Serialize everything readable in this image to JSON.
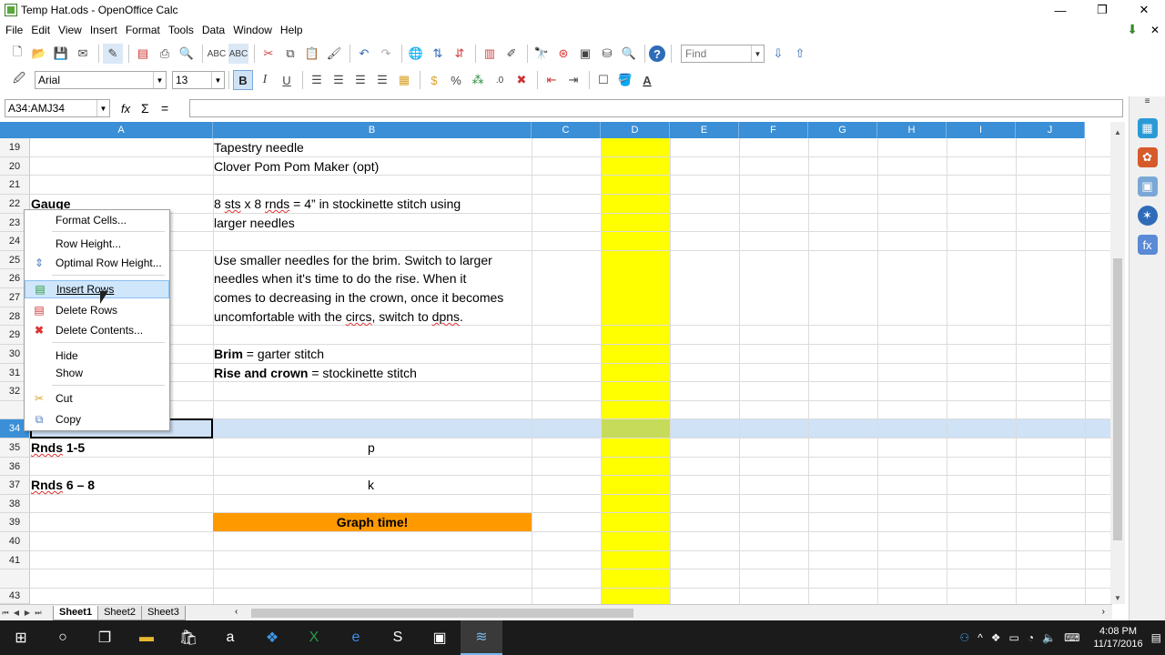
{
  "window": {
    "title": "Temp Hat.ods - OpenOffice Calc",
    "minimize": "—",
    "restore": "❐",
    "close": "✕"
  },
  "menu": [
    "File",
    "Edit",
    "View",
    "Insert",
    "Format",
    "Tools",
    "Data",
    "Window",
    "Help"
  ],
  "toolbar": {
    "find_placeholder": "Find"
  },
  "formatting": {
    "font_name": "Arial",
    "font_size": "13",
    "bold": "B",
    "italic": "I",
    "underline": "U"
  },
  "formula_bar": {
    "name_box": "A34:AMJ34",
    "fx": "fx",
    "sigma": "Σ",
    "equals": "=",
    "content": ""
  },
  "columns": [
    "A",
    "B",
    "C",
    "D",
    "E",
    "F",
    "G",
    "H",
    "I",
    "J"
  ],
  "rows": [
    "19",
    "20",
    "21",
    "22",
    "23",
    "24",
    "25",
    "26",
    "27",
    "28",
    "29",
    "30",
    "31",
    "32",
    "34",
    "35",
    "36",
    "37",
    "38",
    "39",
    "40",
    "41",
    "43"
  ],
  "cells": {
    "b19": "Tapestry needle",
    "b20": "Clover Pom Pom Maker (opt)",
    "a22": "Gauge",
    "b22_pre": "8 ",
    "b22_sts": "sts",
    "b22_mid": " x 8 ",
    "b22_rnds": "rnds",
    "b22_post": " = 4”  in stockinette stitch using",
    "b23": "larger needles",
    "b25": "Use smaller needles for the brim. Switch to larger",
    "b26": "needles when it's time to do the rise. When it",
    "b27": "comes to decreasing in the crown, once it becomes",
    "b28_pre": "uncomfortable with the ",
    "b28_circs": "circs",
    "b28_mid": ", switch to ",
    "b28_dpns": "dpns",
    "b28_post": ".",
    "b30_bold": "Brim",
    "b30_rest": " = garter stitch",
    "b31_bold": "Rise and crown",
    "b31_rest": " = stockinette stitch",
    "a35_rnds": "Rnds",
    "a35_rest": " 1-5",
    "b35": "p",
    "a37_rnds": "Rnds",
    "a37_rest": " 6 – 8",
    "b37": "k",
    "b39": "Graph time!"
  },
  "context_menu": [
    {
      "label": "Format Cells...",
      "icon": "none"
    },
    {
      "label": "Row Height...",
      "icon": "none"
    },
    {
      "label": "Optimal Row Height...",
      "icon": "optimal-row-height-icon"
    },
    {
      "label": "Insert Rows",
      "icon": "insert-rows-icon",
      "highlighted": true
    },
    {
      "label": "Delete Rows",
      "icon": "delete-rows-icon"
    },
    {
      "label": "Delete Contents...",
      "icon": "delete-contents-icon"
    },
    {
      "label": "Hide",
      "icon": "none"
    },
    {
      "label": "Show",
      "icon": "none"
    },
    {
      "label": "Cut",
      "icon": "scissors-icon"
    },
    {
      "label": "Copy",
      "icon": "copy-icon"
    }
  ],
  "sheets": [
    "Sheet1",
    "Sheet2",
    "Sheet3"
  ],
  "active_sheet": "Sheet1",
  "taskbar": {
    "time": "4:08 PM",
    "date": "11/17/2016"
  },
  "colors": {
    "header_blue": "#3a8fd6",
    "highlight_yellow": "#ffff00",
    "orange": "#ff9900",
    "selection": "#cfe2f6"
  }
}
